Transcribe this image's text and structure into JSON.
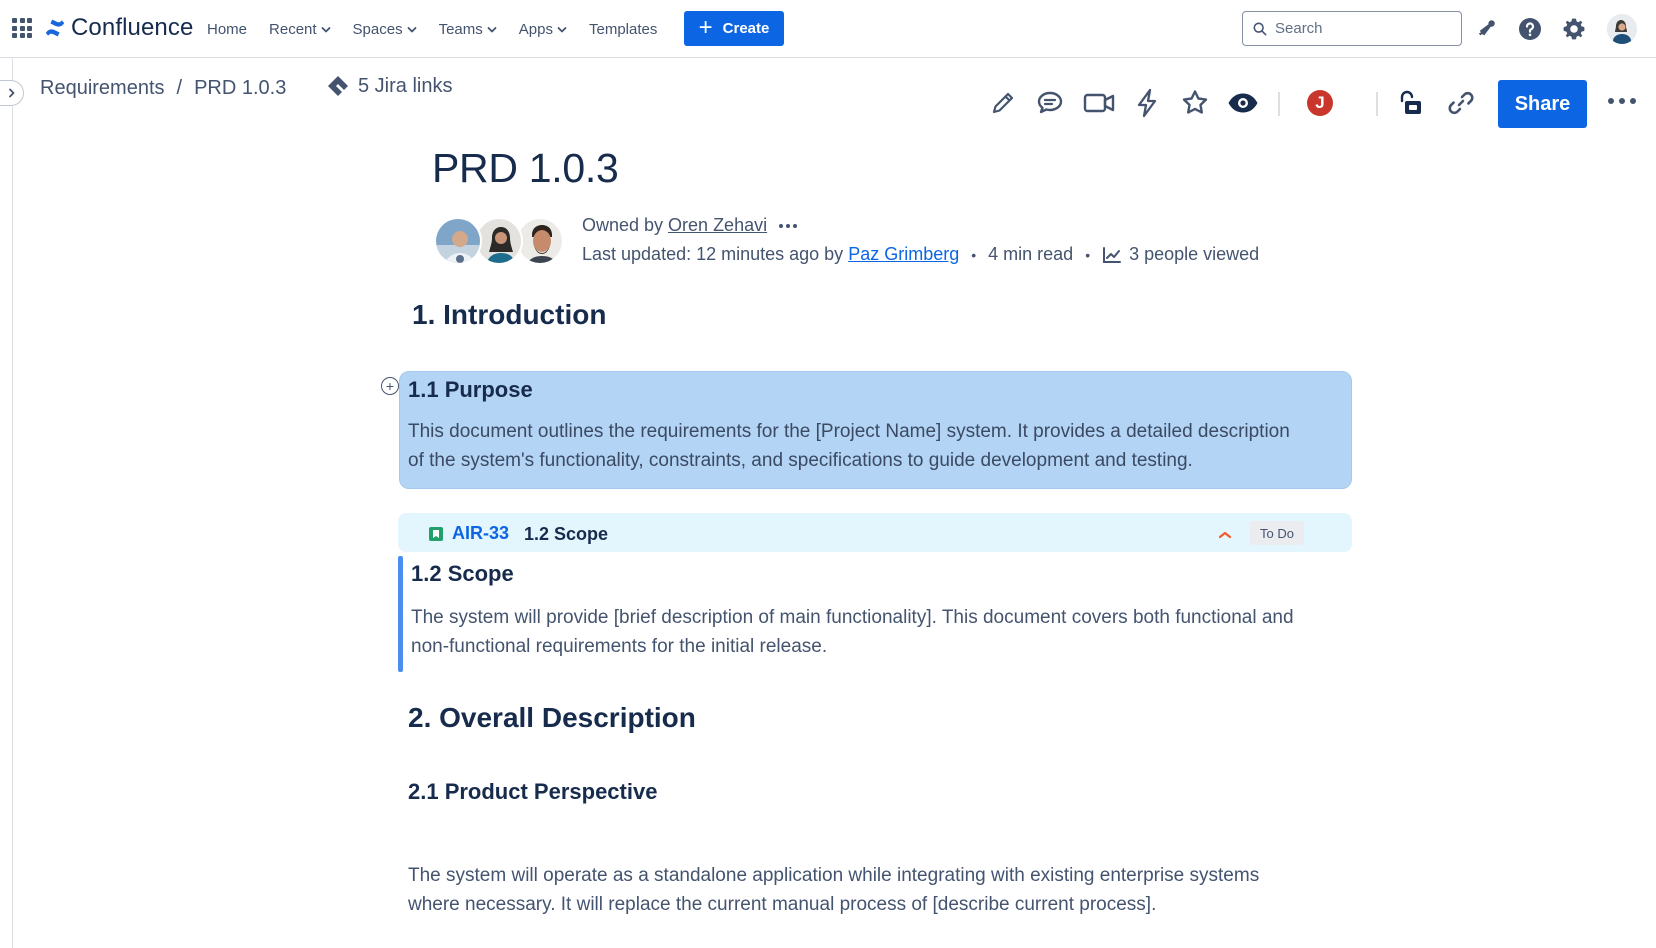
{
  "app": {
    "name": "Confluence",
    "nav": [
      {
        "label": "Home",
        "dropdown": false
      },
      {
        "label": "Recent",
        "dropdown": true
      },
      {
        "label": "Spaces",
        "dropdown": true
      },
      {
        "label": "Teams",
        "dropdown": true
      },
      {
        "label": "Apps",
        "dropdown": true
      },
      {
        "label": "Templates",
        "dropdown": false
      }
    ],
    "create_label": "Create",
    "search_placeholder": "Search",
    "colors": {
      "primary": "#0c66e4",
      "text": "#172b4d",
      "subtle": "#44546f",
      "highlight": "#b3d4f5",
      "jira_bar": "#e3f5fd"
    }
  },
  "breadcrumb": {
    "space": "Requirements",
    "separator": "/",
    "page": "PRD 1.0.3",
    "jira_links": "5 Jira links"
  },
  "toolbar": {
    "presence_initial": "J",
    "share_label": "Share"
  },
  "page": {
    "title": "PRD 1.0.3",
    "owned_prefix": "Owned by",
    "owner": "Oren Zehavi",
    "updated_prefix": "Last updated: 12 minutes ago by",
    "updated_by": "Paz Grimberg",
    "read_time": "4 min read",
    "views": "3 people viewed"
  },
  "content": {
    "intro_heading": "1. Introduction",
    "purpose_heading": "1.1 Purpose",
    "purpose_line1": "This document outlines the requirements for the [Project Name] system. It provides a detailed description",
    "purpose_line2": "of the system's functionality, constraints, and specifications to guide development and testing.",
    "jira_issue": {
      "key": "AIR-33",
      "summary": "1.2 Scope",
      "status": "To Do"
    },
    "scope_heading": "1.2 Scope",
    "scope_line1": "The system will provide [brief description of main functionality]. This document covers both functional and",
    "scope_line2": "non-functional requirements for the initial release.",
    "overall_heading": "2. Overall Description",
    "perspective_heading": "2.1 Product Perspective",
    "perspective_line1": "The system will operate as a standalone application while integrating with existing enterprise systems",
    "perspective_line2": "where necessary. It will replace the current manual process of [describe current process]."
  }
}
